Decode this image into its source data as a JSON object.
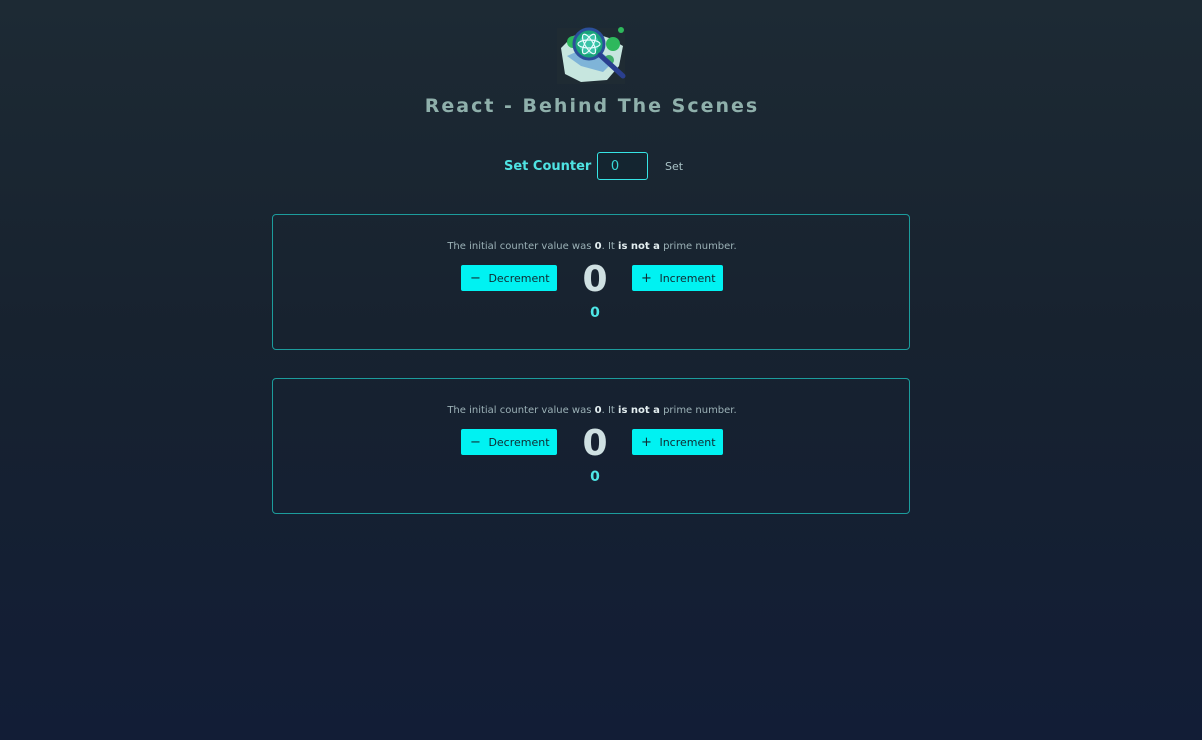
{
  "header": {
    "logo_icon": "magnifier-atom-logo-icon",
    "title": "React - Behind The Scenes"
  },
  "set_counter": {
    "label": "Set Counter",
    "value": "0",
    "button_label": "Set"
  },
  "counters": [
    {
      "info": {
        "prefix": "The initial counter value was",
        "initial": "0",
        "mid": ". It",
        "is_not_a": "is not a",
        "suffix": "prime number."
      },
      "decrement_label": "Decrement",
      "decrement_icon": "minus-icon",
      "increment_label": "Increment",
      "increment_icon": "plus-icon",
      "value": "0",
      "history_value": "0"
    },
    {
      "info": {
        "prefix": "The initial counter value was",
        "initial": "0",
        "mid": ". It",
        "is_not_a": "is not a",
        "suffix": "prime number."
      },
      "decrement_label": "Decrement",
      "decrement_icon": "minus-icon",
      "increment_label": "Increment",
      "increment_icon": "plus-icon",
      "value": "0",
      "history_value": "0"
    }
  ],
  "colors": {
    "accent": "#00f2f2",
    "card_border": "#1c9c9c",
    "title": "#8fb0ab",
    "background_top": "#1d2a34",
    "background_bottom": "#121d36"
  }
}
